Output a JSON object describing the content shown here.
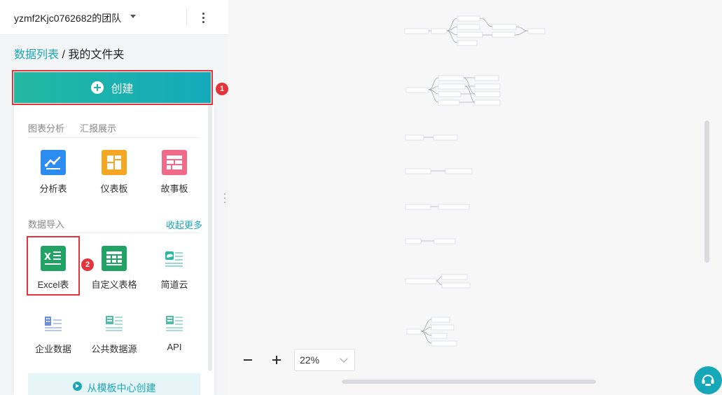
{
  "team": {
    "name": "yzmf2Kjc0762682的团队"
  },
  "breadcrumb": {
    "root": "数据列表",
    "separator": " / ",
    "current": "我的文件夹"
  },
  "create": {
    "label": "创建",
    "step_badge": "1"
  },
  "sections": {
    "tabs": [
      "图表分析",
      "汇报展示"
    ],
    "analysis_tiles": [
      {
        "label": "分析表",
        "icon": "line-chart-icon"
      },
      {
        "label": "仪表板",
        "icon": "dashboard-icon"
      },
      {
        "label": "故事板",
        "icon": "storyboard-icon"
      }
    ],
    "import_title": "数据导入",
    "collapse_more": "收起更多",
    "import_tiles": [
      {
        "label": "Excel表",
        "icon": "excel-icon"
      },
      {
        "label": "自定义表格",
        "icon": "custom-table-icon"
      },
      {
        "label": "简道云",
        "icon": "jiandaoyun-icon"
      },
      {
        "label": "企业数据",
        "icon": "enterprise-data-icon"
      },
      {
        "label": "公共数据源",
        "icon": "public-data-icon"
      },
      {
        "label": "API",
        "icon": "api-icon"
      }
    ],
    "excel_step_badge": "2",
    "template_button": "从模板中心创建"
  },
  "zoom": {
    "value": "22%"
  },
  "colors": {
    "accent": "#1aa6b7",
    "create_start": "#22b8a1",
    "highlight": "#e3343b"
  }
}
